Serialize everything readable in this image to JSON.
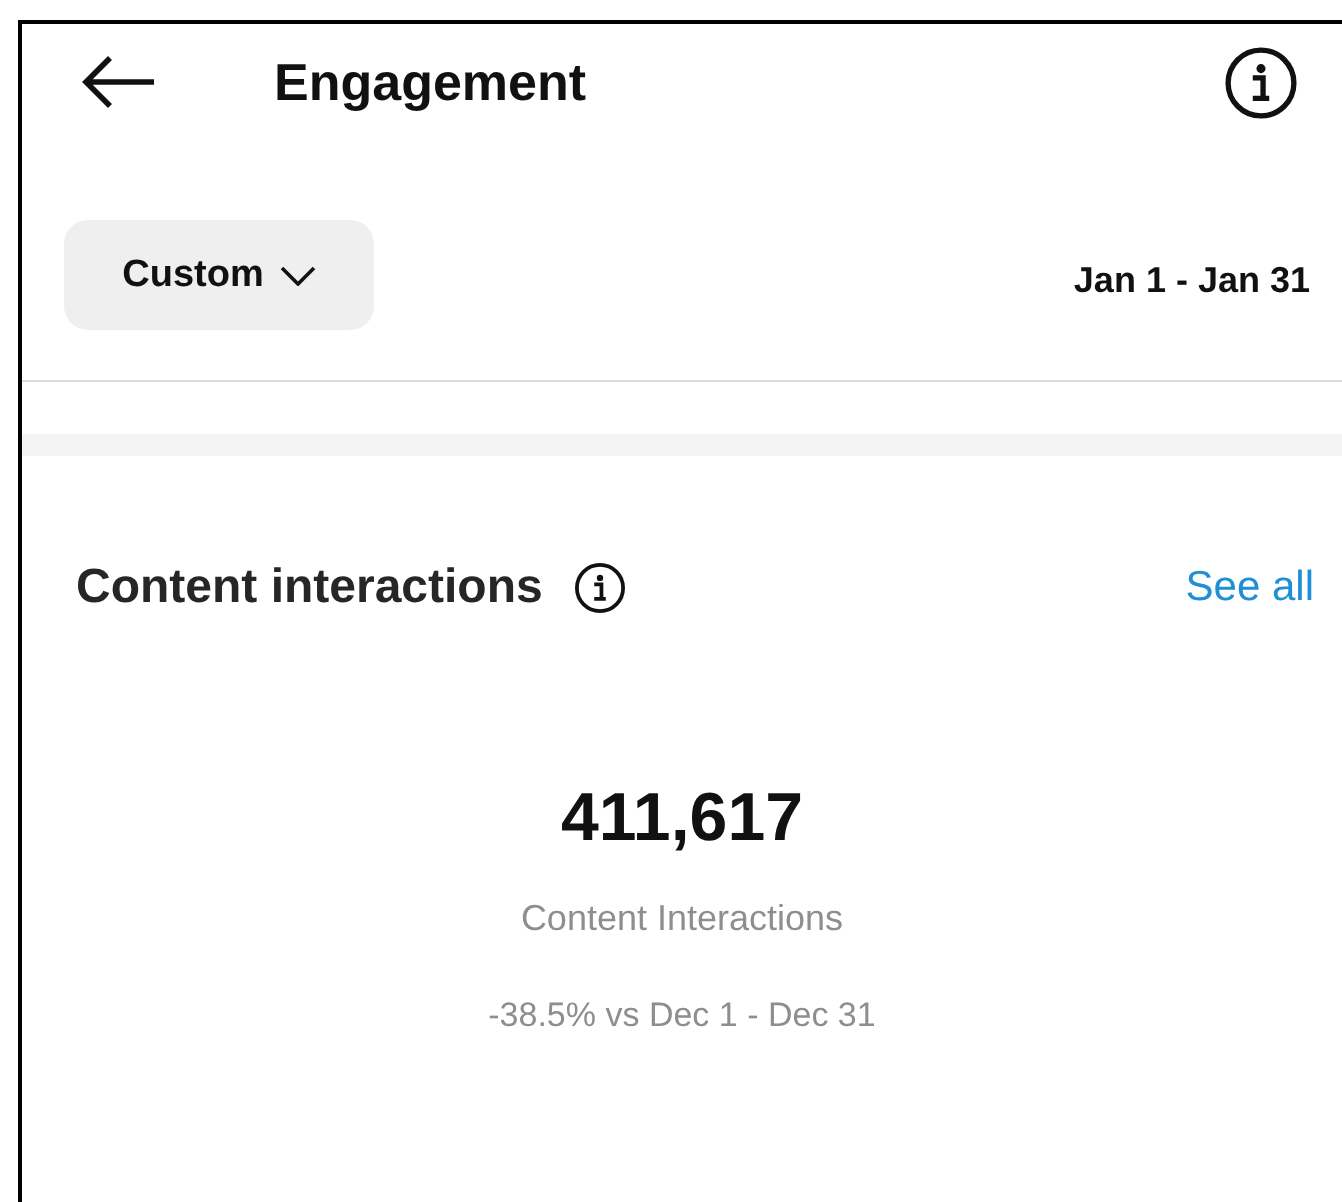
{
  "header": {
    "title": "Engagement"
  },
  "filter": {
    "range_button": "Custom",
    "date_range": "Jan 1 - Jan 31"
  },
  "section": {
    "title": "Content interactions",
    "link": "See all",
    "metric": {
      "value": "411,617",
      "label": "Content Interactions",
      "comparison": "-38.5% vs Dec 1 - Dec 31"
    }
  }
}
